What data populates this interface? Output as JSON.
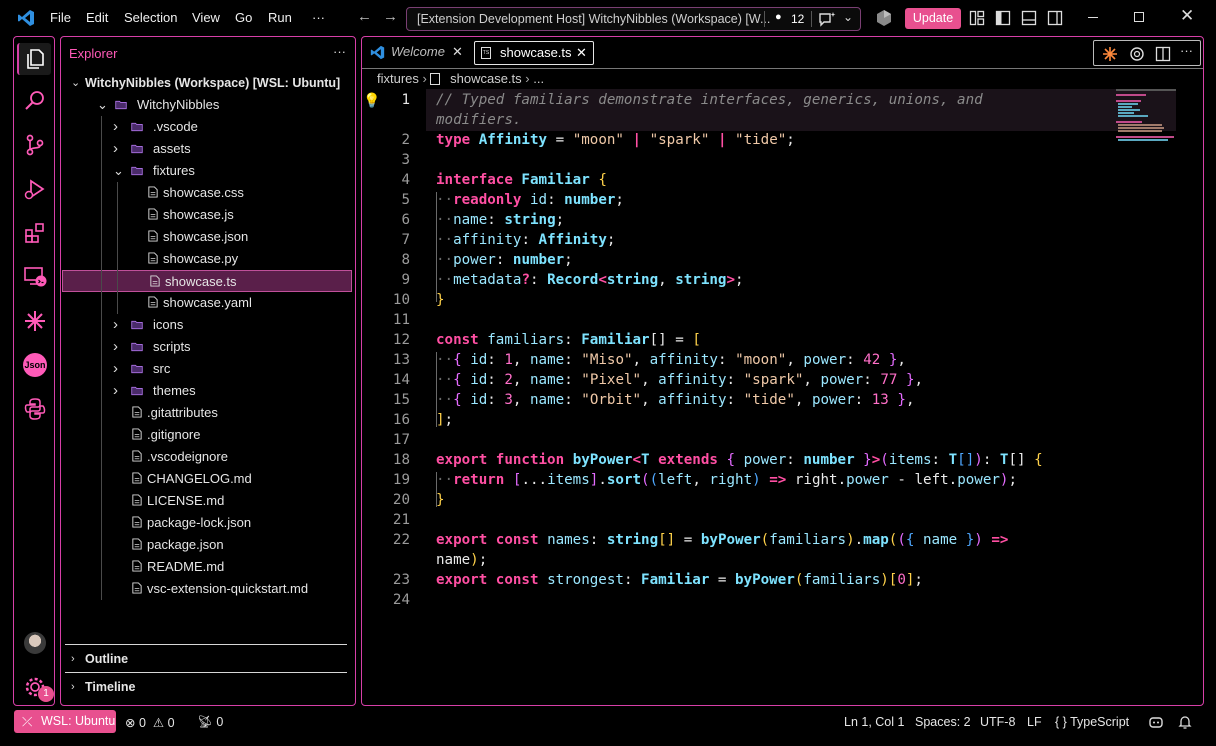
{
  "titlebar": {
    "menu": [
      "File",
      "Edit",
      "Selection",
      "View",
      "Go",
      "Run",
      "···"
    ],
    "command_center": "[Extension Development Host] WitchyNibbles (Workspace) [W...",
    "changes_count": "12",
    "update_label": "Update"
  },
  "activitybar": {
    "icons": [
      "explorer-icon",
      "search-icon",
      "source-control-icon",
      "run-debug-icon",
      "extensions-icon",
      "remote-explorer-icon",
      "sparkle-icon",
      "json-icon",
      "python-icon"
    ],
    "json_label": "Json",
    "settings_badge": "1"
  },
  "sidebar": {
    "title": "Explorer",
    "more": "···",
    "workspace": "WitchyNibbles (Workspace) [WSL: Ubuntu]",
    "items": [
      {
        "label": "WitchyNibbles",
        "type": "folder-open",
        "depth": 1
      },
      {
        "label": ".vscode",
        "type": "folder",
        "depth": 2
      },
      {
        "label": "assets",
        "type": "folder",
        "depth": 2
      },
      {
        "label": "fixtures",
        "type": "folder-open",
        "depth": 2
      },
      {
        "label": "showcase.css",
        "type": "file",
        "depth": 3
      },
      {
        "label": "showcase.js",
        "type": "file",
        "depth": 3
      },
      {
        "label": "showcase.json",
        "type": "file",
        "depth": 3
      },
      {
        "label": "showcase.py",
        "type": "file",
        "depth": 3
      },
      {
        "label": "showcase.ts",
        "type": "file",
        "depth": 3,
        "selected": true
      },
      {
        "label": "showcase.yaml",
        "type": "file",
        "depth": 3
      },
      {
        "label": "icons",
        "type": "folder",
        "depth": 2
      },
      {
        "label": "scripts",
        "type": "folder",
        "depth": 2
      },
      {
        "label": "src",
        "type": "folder",
        "depth": 2
      },
      {
        "label": "themes",
        "type": "folder",
        "depth": 2
      },
      {
        "label": ".gitattributes",
        "type": "file",
        "depth": 2
      },
      {
        "label": ".gitignore",
        "type": "file",
        "depth": 2
      },
      {
        "label": ".vscodeignore",
        "type": "file",
        "depth": 2
      },
      {
        "label": "CHANGELOG.md",
        "type": "file",
        "depth": 2
      },
      {
        "label": "LICENSE.md",
        "type": "file",
        "depth": 2
      },
      {
        "label": "package-lock.json",
        "type": "file",
        "depth": 2
      },
      {
        "label": "package.json",
        "type": "file",
        "depth": 2
      },
      {
        "label": "README.md",
        "type": "file",
        "depth": 2
      },
      {
        "label": "vsc-extension-quickstart.md",
        "type": "file",
        "depth": 2
      }
    ],
    "outline": "Outline",
    "timeline": "Timeline"
  },
  "editor": {
    "tabs": [
      {
        "label": "Welcome",
        "italic": true
      },
      {
        "label": "showcase.ts",
        "active": true
      }
    ],
    "breadcrumb": [
      "fixtures",
      "showcase.ts",
      "..."
    ],
    "line_numbers": [
      "1",
      "2",
      "3",
      "4",
      "5",
      "6",
      "7",
      "8",
      "9",
      "10",
      "11",
      "12",
      "13",
      "14",
      "15",
      "16",
      "17",
      "18",
      "19",
      "20",
      "21",
      "22",
      "23",
      "24"
    ]
  },
  "statusbar": {
    "remote": "WSL: Ubuntu",
    "errors": "0",
    "warnings": "0",
    "ports": "0",
    "position": "Ln 1, Col 1",
    "spaces": "Spaces: 2",
    "encoding": "UTF-8",
    "eol": "LF",
    "language": "TypeScript",
    "language_brace": "{ }"
  },
  "colors": {
    "accent": "#d63fa8",
    "button": "#e8508f",
    "selected": "#5a1f4a"
  }
}
